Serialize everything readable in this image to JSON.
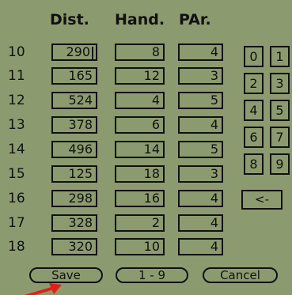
{
  "columns": [
    "Dist.",
    "Hand.",
    "PAr."
  ],
  "rows": [
    {
      "hole": "10",
      "dist": "290",
      "hand": "8",
      "par": "4"
    },
    {
      "hole": "11",
      "dist": "165",
      "hand": "12",
      "par": "3"
    },
    {
      "hole": "12",
      "dist": "524",
      "hand": "4",
      "par": "5"
    },
    {
      "hole": "13",
      "dist": "378",
      "hand": "6",
      "par": "4"
    },
    {
      "hole": "14",
      "dist": "496",
      "hand": "14",
      "par": "5"
    },
    {
      "hole": "15",
      "dist": "125",
      "hand": "18",
      "par": "3"
    },
    {
      "hole": "16",
      "dist": "298",
      "hand": "16",
      "par": "4"
    },
    {
      "hole": "17",
      "dist": "328",
      "hand": "2",
      "par": "4"
    },
    {
      "hole": "18",
      "dist": "320",
      "hand": "10",
      "par": "4"
    }
  ],
  "keypad": [
    "0",
    "1",
    "2",
    "3",
    "4",
    "5",
    "6",
    "7",
    "8",
    "9"
  ],
  "backspace_label": "<-",
  "buttons": {
    "save": "Save",
    "front_nine": "1 - 9",
    "cancel": "Cancel"
  },
  "colors": {
    "screen": "#8b9b6f",
    "ink": "#111111",
    "arrow": "#e0201a"
  },
  "icons": {
    "pointer": "red-arrow-icon"
  }
}
